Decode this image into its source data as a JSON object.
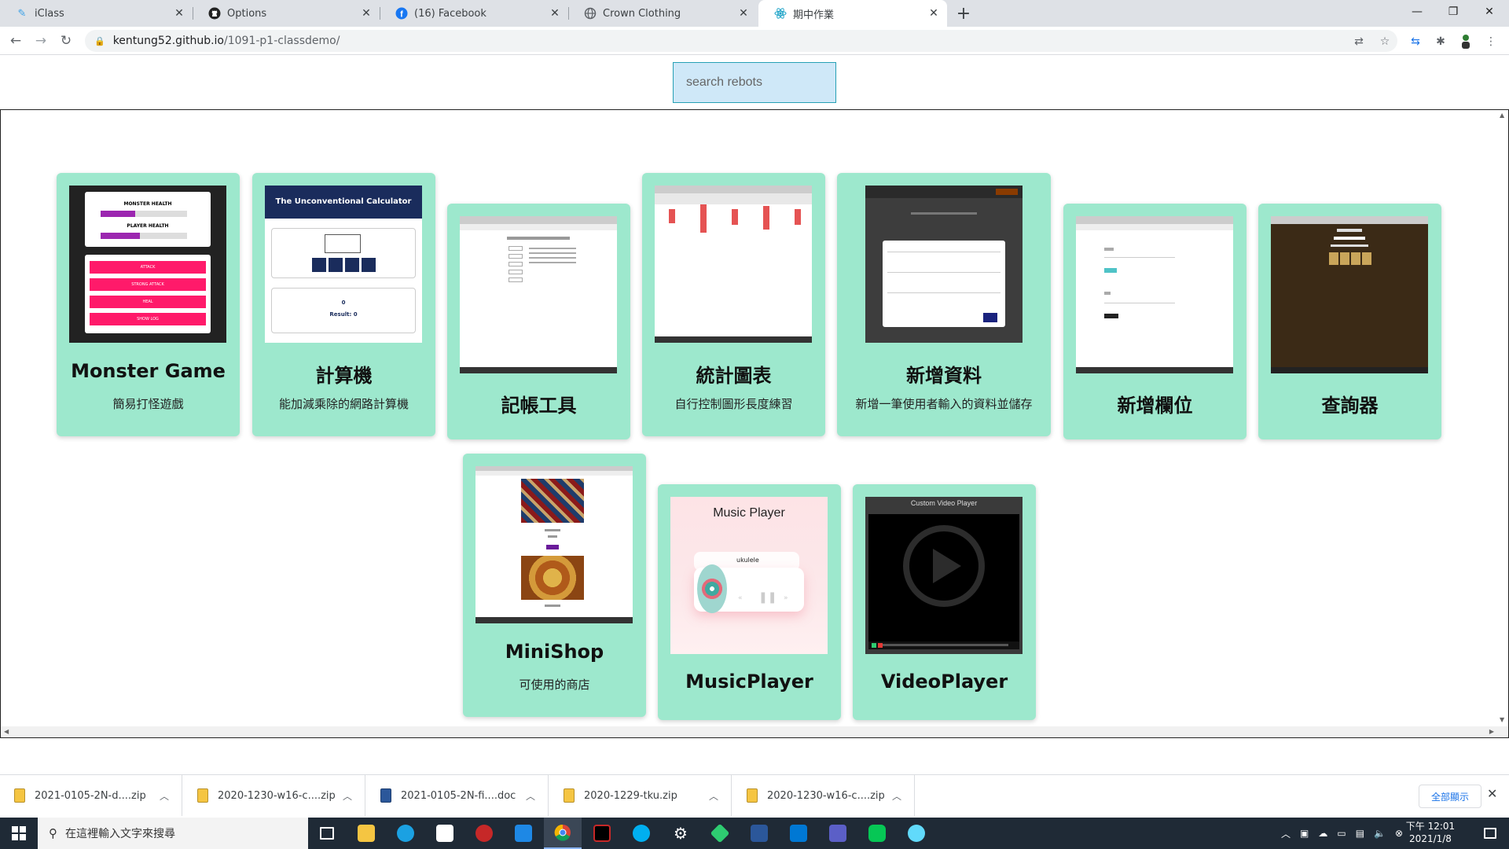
{
  "browser": {
    "tabs": [
      {
        "title": "iClass",
        "icon": "iclass-icon"
      },
      {
        "title": "Options",
        "icon": "github-icon"
      },
      {
        "title": "(16) Facebook",
        "icon": "facebook-icon"
      },
      {
        "title": "Crown Clothing",
        "icon": "globe-icon"
      },
      {
        "title": "期中作業",
        "icon": "react-icon",
        "active": true
      }
    ],
    "url_host": "kentung52.github.io",
    "url_path": "/1091-p1-classdemo/"
  },
  "search": {
    "placeholder": "search rebots",
    "value": ""
  },
  "cards": [
    {
      "title": "Monster Game",
      "desc": "簡易打怪遊戲",
      "thumb": "monster-game-screenshot"
    },
    {
      "title": "計算機",
      "desc": "能加減乘除的網路計算機",
      "thumb": "calculator-screenshot"
    },
    {
      "title": "記帳工具",
      "desc": "",
      "thumb": "expense-tool-screenshot"
    },
    {
      "title": "統計圖表",
      "desc": "自行控制圖形長度練習",
      "thumb": "chart-screenshot"
    },
    {
      "title": "新增資料",
      "desc": "新增一筆使用者輸入的資料並儲存",
      "thumb": "add-data-screenshot"
    },
    {
      "title": "新增欄位",
      "desc": "",
      "thumb": "add-field-screenshot"
    },
    {
      "title": "查詢器",
      "desc": "",
      "thumb": "query-screenshot"
    },
    {
      "title": "MiniShop",
      "desc": "可使用的商店",
      "thumb": "minishop-screenshot"
    },
    {
      "title": "MusicPlayer",
      "desc": "",
      "thumb": "music-player-screenshot"
    },
    {
      "title": "VideoPlayer",
      "desc": "",
      "thumb": "video-player-screenshot"
    }
  ],
  "thumb_text": {
    "monster_health": "MONSTER HEALTH",
    "player_health": "PLAYER HEALTH",
    "attack": "ATTACK",
    "strong_attack": "STRONG ATTACK",
    "heal": "HEAL",
    "show_log": "SHOW LOG",
    "calc_title": "The Unconventional Calculator",
    "calc_zero": "0",
    "calc_result": "Result: 0",
    "music_title": "Music Player",
    "music_song": "ukulele",
    "video_title": "Custom Video Player"
  },
  "downloads": {
    "items": [
      {
        "name": "2021-0105-2N-d....zip",
        "type": "zip"
      },
      {
        "name": "2020-1230-w16-c....zip",
        "type": "zip"
      },
      {
        "name": "2021-0105-2N-fi....doc",
        "type": "doc"
      },
      {
        "name": "2020-1229-tku.zip",
        "type": "zip"
      },
      {
        "name": "2020-1230-w16-c....zip",
        "type": "zip"
      }
    ],
    "show_all": "全部顯示"
  },
  "taskbar": {
    "search_placeholder": "在這裡輸入文字來搜尋",
    "time": "下午 12:01",
    "date": "2021/1/8"
  },
  "colors": {
    "card_bg": "#9de8cd",
    "search_bg": "#cfe8f8",
    "taskbar_bg": "#1f2a36"
  }
}
